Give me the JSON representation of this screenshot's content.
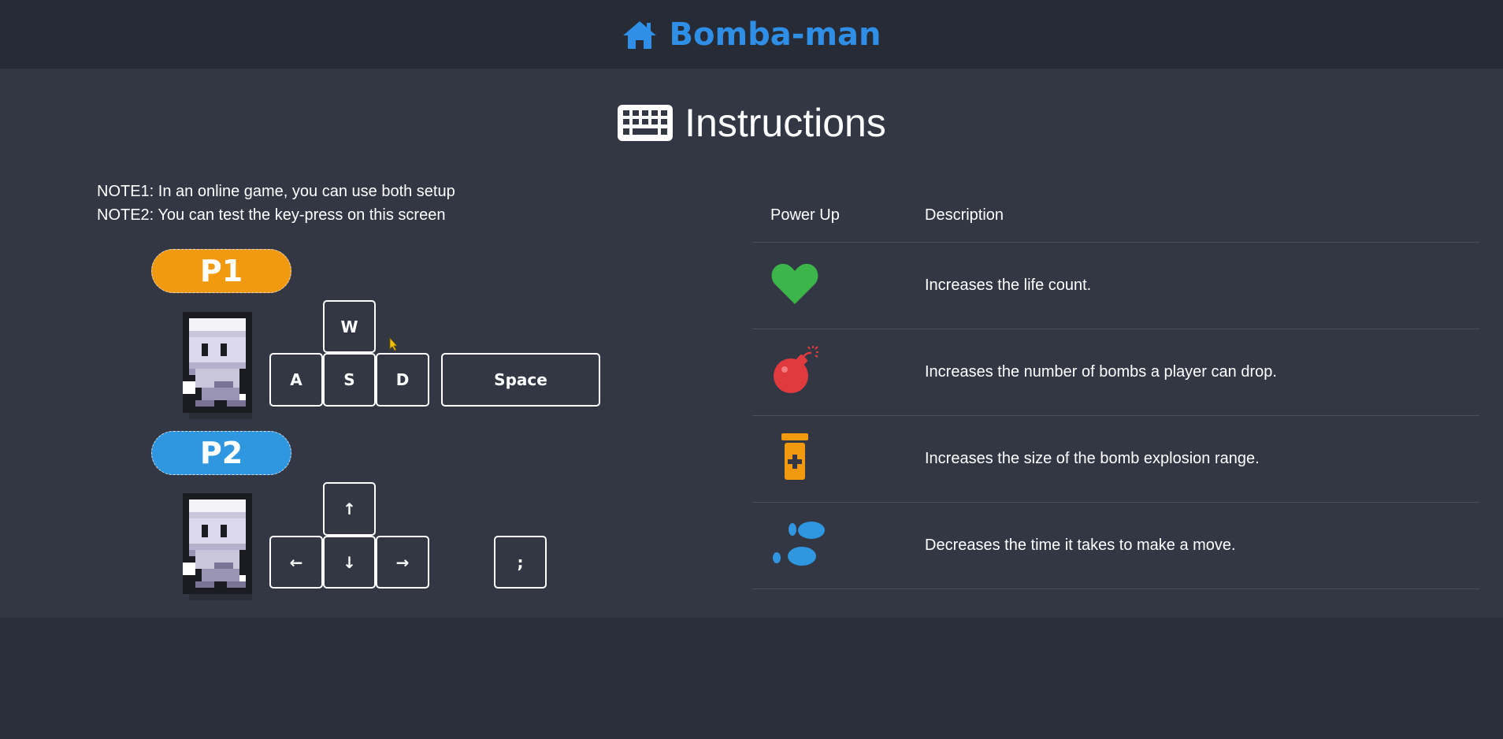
{
  "header": {
    "title": "Bomba-man",
    "icon": "home-icon",
    "color": "#2f8fe6"
  },
  "instructions": {
    "title": "Instructions",
    "icon": "keyboard-icon"
  },
  "notes": [
    "NOTE1: In an online game, you can use both setup",
    "NOTE2: You can test the key-press on this screen"
  ],
  "players": [
    {
      "label": "P1",
      "color": "#f29a0f",
      "keys": {
        "up": "W",
        "left": "A",
        "down": "S",
        "right": "D",
        "action": "Space"
      }
    },
    {
      "label": "P2",
      "color": "#2f96e0",
      "keys": {
        "up": "↑",
        "left": "←",
        "down": "↓",
        "right": "→",
        "action": ";"
      }
    }
  ],
  "powerups": {
    "headers": [
      "Power Up",
      "Description"
    ],
    "rows": [
      {
        "icon": "heart-icon",
        "color": "#3cb54a",
        "description": "Increases the life count."
      },
      {
        "icon": "bomb-icon",
        "color": "#e03a3e",
        "description": "Increases the number of bombs a player can drop."
      },
      {
        "icon": "potion-icon",
        "color": "#f29a0f",
        "description": "Increases the size of the bomb explosion range."
      },
      {
        "icon": "footsteps-icon",
        "color": "#2f96e0",
        "description": "Decreases the time it takes to make a move."
      }
    ]
  }
}
